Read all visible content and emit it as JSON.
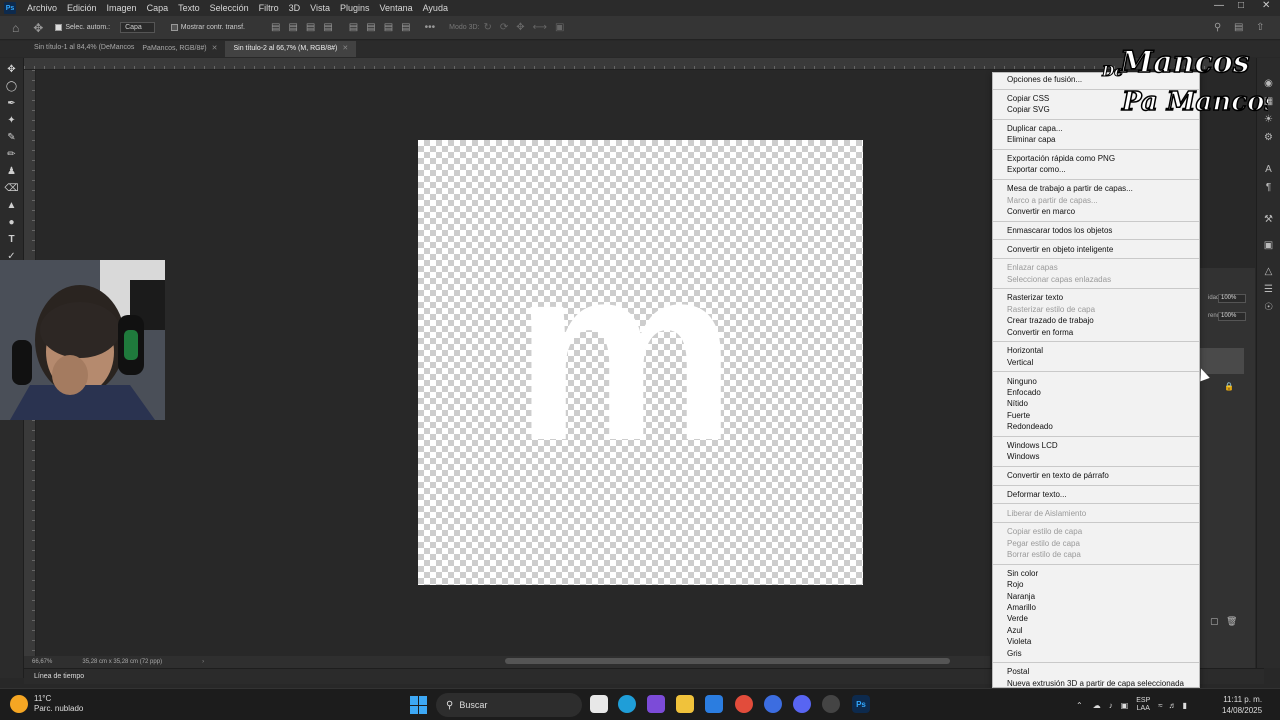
{
  "menubar": {
    "app_logo": "Ps",
    "items": [
      "Archivo",
      "Edición",
      "Imagen",
      "Capa",
      "Texto",
      "Selección",
      "Filtro",
      "3D",
      "Vista",
      "Plugins",
      "Ventana",
      "Ayuda"
    ]
  },
  "options": {
    "auto_select_label": "Selec. autom.:",
    "auto_select_value": "Capa",
    "transform_label": "Mostrar contr. transf.",
    "mode3d_label": "Modo 3D:"
  },
  "tabs": [
    {
      "label": "Sin título-1 al 84,4% (DeMancos",
      "active": false
    },
    {
      "label": "PaMancos, RGB/8#)",
      "active": false
    },
    {
      "label": "Sin título-2 al 66,7% (M, RGB/8#)",
      "active": true
    }
  ],
  "canvas": {
    "letter": "m"
  },
  "status": {
    "zoom": "66,67%",
    "doc_size": "35,28 cm x 35,28 cm (72 ppp)"
  },
  "timeline_label": "Línea de tiempo",
  "panel": {
    "opacity1": "100%",
    "opacity2": "100%",
    "label1": "idad:",
    "label2": "reno:"
  },
  "watermark": {
    "line1": "Mancos",
    "line2": "Pa Mancos",
    "small": "De"
  },
  "context_menu": [
    {
      "label": "Opciones de fusión...",
      "disabled": false
    },
    {
      "sep": true
    },
    {
      "label": "Copiar CSS",
      "disabled": false
    },
    {
      "label": "Copiar SVG",
      "disabled": false
    },
    {
      "sep": true
    },
    {
      "label": "Duplicar capa...",
      "disabled": false
    },
    {
      "label": "Eliminar capa",
      "disabled": false
    },
    {
      "sep": true
    },
    {
      "label": "Exportación rápida como PNG",
      "disabled": false
    },
    {
      "label": "Exportar como...",
      "disabled": false
    },
    {
      "sep": true
    },
    {
      "label": "Mesa de trabajo a partir de capas...",
      "disabled": false
    },
    {
      "label": "Marco a partir de capas...",
      "disabled": true
    },
    {
      "label": "Convertir en marco",
      "disabled": false
    },
    {
      "sep": true
    },
    {
      "label": "Enmascarar todos los objetos",
      "disabled": false
    },
    {
      "sep": true
    },
    {
      "label": "Convertir en objeto inteligente",
      "disabled": false
    },
    {
      "sep": true
    },
    {
      "label": "Enlazar capas",
      "disabled": true
    },
    {
      "label": "Seleccionar capas enlazadas",
      "disabled": true
    },
    {
      "sep": true
    },
    {
      "label": "Rasterizar texto",
      "disabled": false
    },
    {
      "label": "Rasterizar estilo de capa",
      "disabled": true
    },
    {
      "label": "Crear trazado de trabajo",
      "disabled": false
    },
    {
      "label": "Convertir en forma",
      "disabled": false
    },
    {
      "sep": true
    },
    {
      "label": "Horizontal",
      "disabled": false
    },
    {
      "label": "Vertical",
      "disabled": false
    },
    {
      "sep": true
    },
    {
      "label": "Ninguno",
      "disabled": false
    },
    {
      "label": "Enfocado",
      "disabled": false
    },
    {
      "label": "Nítido",
      "disabled": false
    },
    {
      "label": "Fuerte",
      "disabled": false
    },
    {
      "label": "Redondeado",
      "disabled": false
    },
    {
      "sep": true
    },
    {
      "label": "Windows LCD",
      "disabled": false
    },
    {
      "label": "Windows",
      "disabled": false
    },
    {
      "sep": true
    },
    {
      "label": "Convertir en texto de párrafo",
      "disabled": false
    },
    {
      "sep": true
    },
    {
      "label": "Deformar texto...",
      "disabled": false
    },
    {
      "sep": true
    },
    {
      "label": "Liberar de Aislamiento",
      "disabled": true
    },
    {
      "sep": true
    },
    {
      "label": "Copiar estilo de capa",
      "disabled": true
    },
    {
      "label": "Pegar estilo de capa",
      "disabled": true
    },
    {
      "label": "Borrar estilo de capa",
      "disabled": true
    },
    {
      "sep": true
    },
    {
      "label": "Sin color",
      "disabled": false
    },
    {
      "label": "Rojo",
      "disabled": false
    },
    {
      "label": "Naranja",
      "disabled": false
    },
    {
      "label": "Amarillo",
      "disabled": false
    },
    {
      "label": "Verde",
      "disabled": false
    },
    {
      "label": "Azul",
      "disabled": false
    },
    {
      "label": "Violeta",
      "disabled": false
    },
    {
      "label": "Gris",
      "disabled": false
    },
    {
      "sep": true
    },
    {
      "label": "Postal",
      "disabled": false
    },
    {
      "label": "Nueva extrusión 3D a partir de capa seleccionada",
      "disabled": false
    }
  ],
  "taskbar": {
    "weather_temp": "11°C",
    "weather_desc": "Parc. nublado",
    "search_placeholder": "Buscar",
    "lang_top": "ESP",
    "lang_bottom": "LAA",
    "time": "11:11 p. m.",
    "date": "14/08/2025"
  },
  "colors": {
    "accent": "#31a8ff",
    "menu_bg": "#f2f2f2",
    "ui_bg": "#282828"
  }
}
